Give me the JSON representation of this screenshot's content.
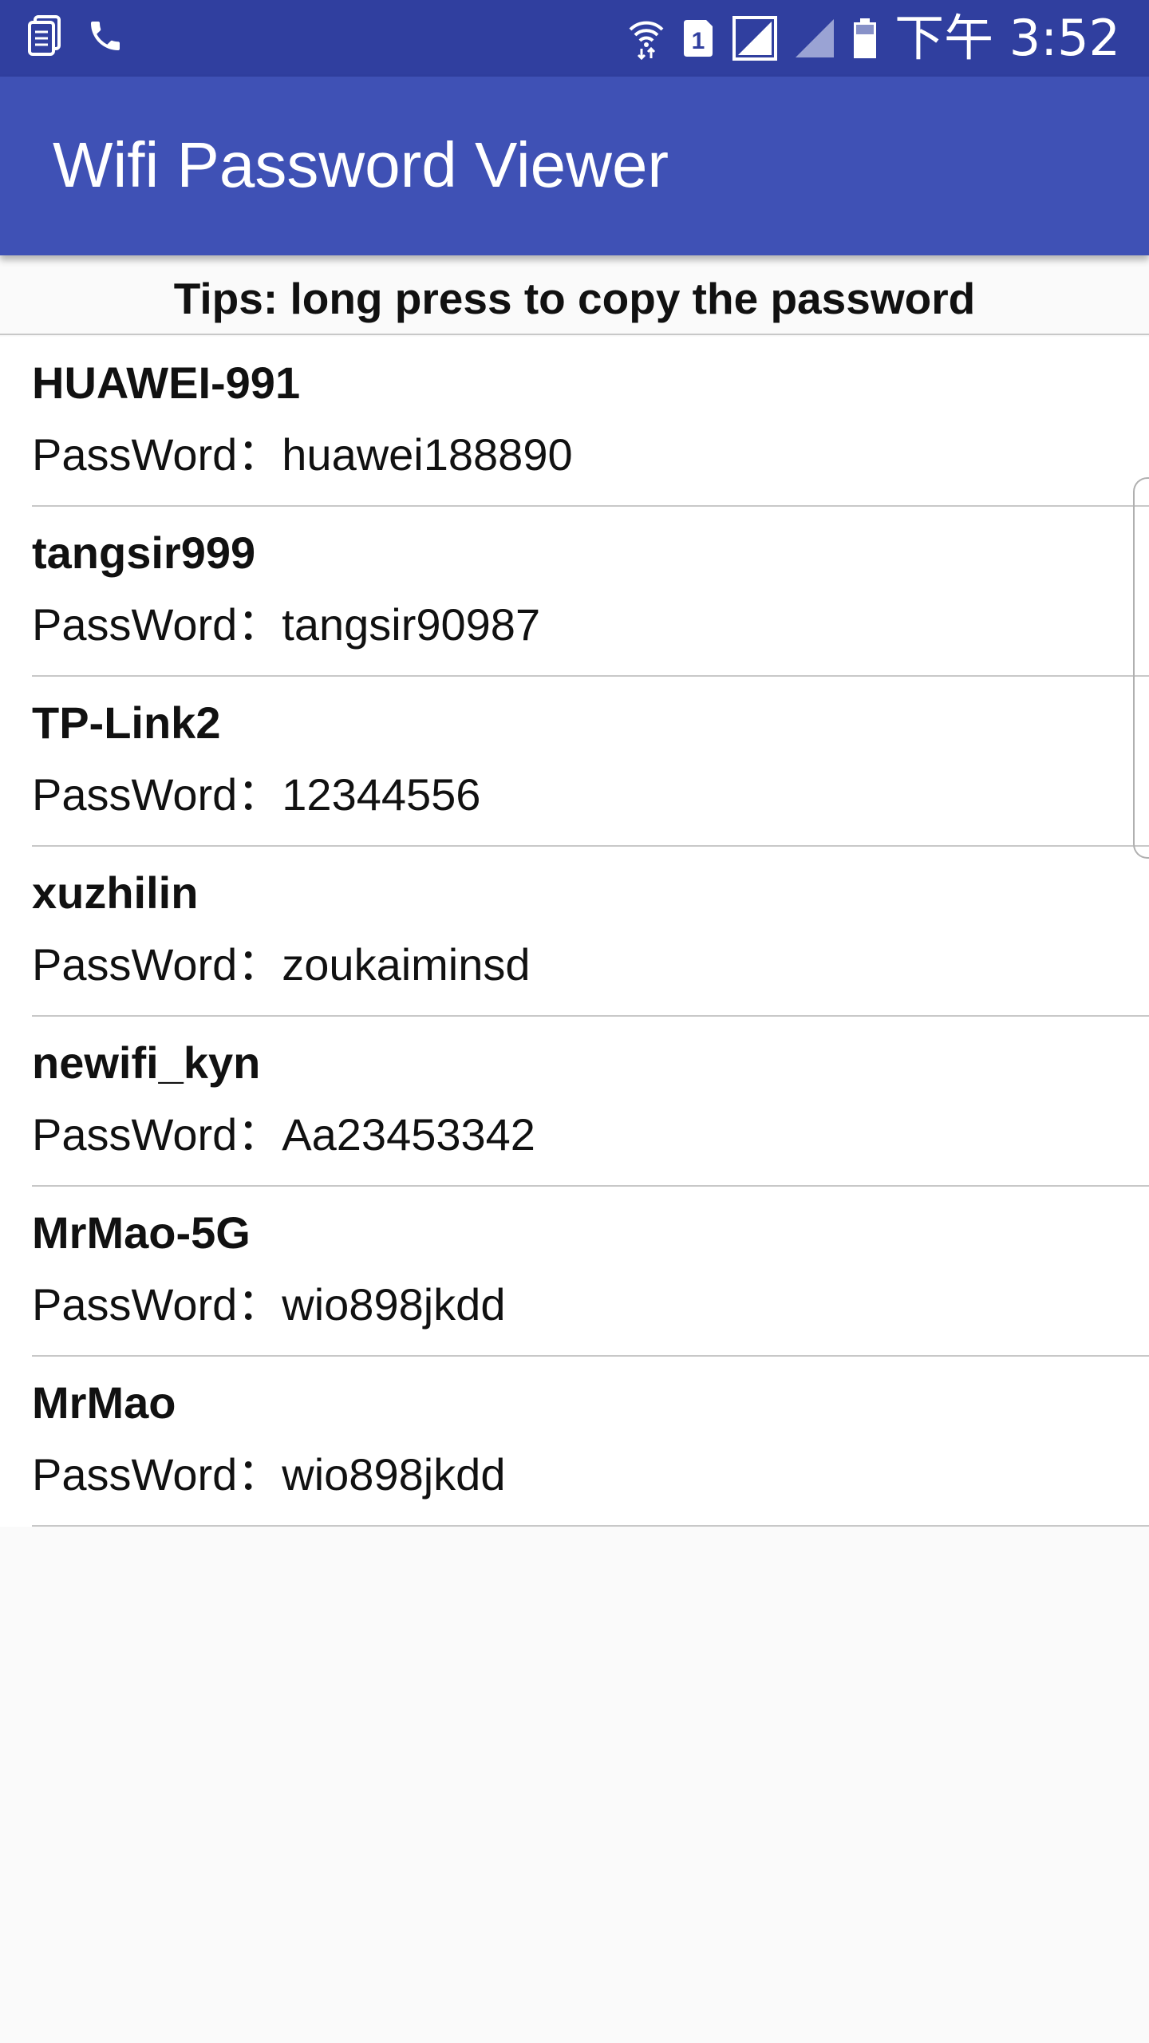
{
  "status_bar": {
    "left_icons": [
      "notes-icon",
      "phone-icon"
    ],
    "right_icons": [
      "wifi-icon",
      "sim-card-icon",
      "signal-icon",
      "signal-weak-icon",
      "battery-icon"
    ],
    "sim_number": "1",
    "time": "下午 3:52",
    "background": "#303f9f"
  },
  "app_bar": {
    "title": "Wifi Password Viewer",
    "background": "#3f51b5"
  },
  "tips": "Tips: long press to copy the password",
  "wifi_list": [
    {
      "ssid": "HUAWEI-991",
      "password_label": "PassWord：huawei188890"
    },
    {
      "ssid": "tangsir999",
      "password_label": "PassWord：tangsir90987"
    },
    {
      "ssid": "TP-Link2",
      "password_label": "PassWord：12344556"
    },
    {
      "ssid": "xuzhilin",
      "password_label": "PassWord：zoukaiminsd"
    },
    {
      "ssid": "newifi_kyn",
      "password_label": "PassWord：Aa23453342"
    },
    {
      "ssid": "MrMao-5G",
      "password_label": "PassWord：wio898jkdd"
    },
    {
      "ssid": "MrMao",
      "password_label": "PassWord：wio898jkdd"
    }
  ]
}
